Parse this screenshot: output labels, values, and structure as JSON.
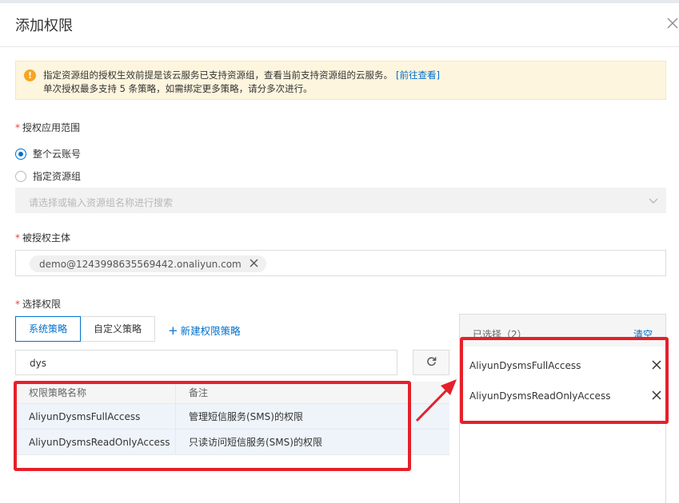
{
  "dialog": {
    "title": "添加权限"
  },
  "alert": {
    "line1": "指定资源组的授权生效前提是该云服务已支持资源组，查看当前支持资源组的云服务。",
    "link": "[前往查看]",
    "line2": "单次授权最多支持 5 条策略，如需绑定更多策略，请分多次进行。"
  },
  "scope": {
    "label": "授权应用范围",
    "options": [
      {
        "label": "整个云账号",
        "checked": true
      },
      {
        "label": "指定资源组",
        "checked": false
      }
    ],
    "resource_group_placeholder": "请选择或输入资源组名称进行搜索"
  },
  "principal": {
    "label": "被授权主体",
    "tag": "demo@1243998635569442.onaliyun.com"
  },
  "permissions": {
    "label": "选择权限",
    "tabs": [
      "系统策略",
      "自定义策略"
    ],
    "active_tab": 0,
    "new_policy": "新建权限策略",
    "search_value": "dys",
    "table": {
      "headers": [
        "权限策略名称",
        "备注"
      ],
      "rows": [
        [
          "AliyunDysmsFullAccess",
          "管理短信服务(SMS)的权限"
        ],
        [
          "AliyunDysmsReadOnlyAccess",
          "只读访问短信服务(SMS)的权限"
        ]
      ]
    }
  },
  "selected": {
    "title": "已选择（2）",
    "clear": "清空",
    "items": [
      "AliyunDysmsFullAccess",
      "AliyunDysmsReadOnlyAccess"
    ]
  },
  "colors": {
    "accent": "#0070cc",
    "required": "#e64545",
    "highlight": "#e5202a",
    "alert_bg": "#fdf5de",
    "warning_icon": "#f5a623"
  }
}
